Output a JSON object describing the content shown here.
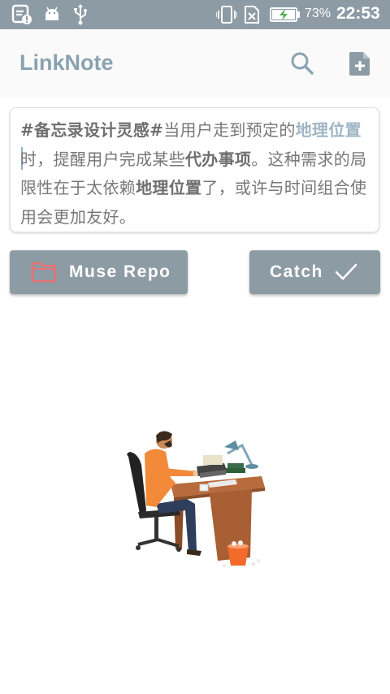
{
  "status_bar": {
    "battery_percent": "73%",
    "time": "22:53"
  },
  "app_bar": {
    "title": "LinkNote",
    "icons": [
      "search-icon",
      "note-add-icon"
    ]
  },
  "note": {
    "segments": [
      {
        "text": "#备忘录设计灵感#",
        "style": "tag"
      },
      {
        "text": "当用户走到预定的",
        "style": "plain"
      },
      {
        "text": "地理位置",
        "style": "link"
      },
      {
        "text": "时，提醒用户完成某些",
        "style": "plain"
      },
      {
        "text": "代办事项",
        "style": "bold"
      },
      {
        "text": "。这种需求的局限性在于太依赖",
        "style": "plain"
      },
      {
        "text": "地理位置",
        "style": "bold"
      },
      {
        "text": "了，或许与时间组合使用会更加友好。",
        "style": "plain"
      }
    ]
  },
  "buttons": {
    "muse_repo": {
      "label": "Muse Repo",
      "icon": "folder-icon"
    },
    "catch": {
      "label": "Catch",
      "icon": "checkmark-icon"
    }
  },
  "colors": {
    "primary": "#8d9ba5",
    "title": "#8aa2b0",
    "link": "#9fb6c5",
    "folder_accent": "#e57373"
  }
}
